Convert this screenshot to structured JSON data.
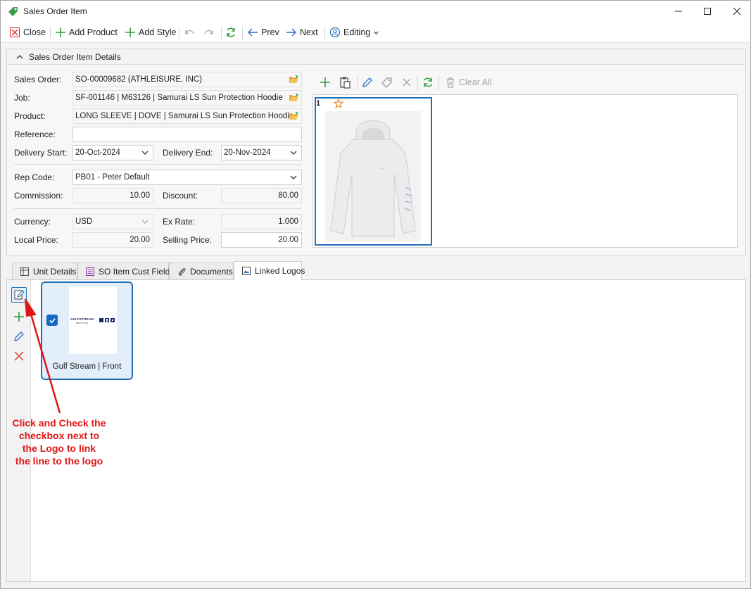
{
  "window": {
    "title": "Sales Order Item",
    "app_icon": "tag-icon"
  },
  "toolbar": {
    "close": "Close",
    "add_product": "Add Product",
    "add_style": "Add Style",
    "prev": "Prev",
    "next": "Next",
    "editing": "Editing"
  },
  "details": {
    "group_title": "Sales Order Item Details",
    "sales_order_label": "Sales Order:",
    "sales_order": "SO-00009682  (ATHLEISURE, INC)",
    "job_label": "Job:",
    "job": "SF-001146 | M63126 | Samurai LS Sun Protection Hoodie",
    "product_label": "Product:",
    "product": "LONG SLEEVE | DOVE | Samurai LS Sun Protection Hoodie",
    "reference_label": "Reference:",
    "reference": "",
    "delivery_start_label": "Delivery Start:",
    "delivery_start": "20-Oct-2024",
    "delivery_end_label": "Delivery End:",
    "delivery_end": "20-Nov-2024",
    "rep_code_label": "Rep Code:",
    "rep_code": "PB01 - Peter Default",
    "commission_label": "Commission:",
    "commission": "10.00",
    "discount_label": "Discount:",
    "discount": "80.00",
    "currency_label": "Currency:",
    "currency": "USD",
    "ex_rate_label": "Ex Rate:",
    "ex_rate": "1.000",
    "local_price_label": "Local Price:",
    "local_price": "20.00",
    "selling_price_label": "Selling Price:",
    "selling_price": "20.00"
  },
  "images": {
    "clear_all": "Clear All",
    "items": [
      {
        "number": "1",
        "favorite": true,
        "description": "white hoodie"
      }
    ]
  },
  "tabs": [
    "Unit Details",
    "SO Item Cust Fields",
    "Documents",
    "Linked Logos"
  ],
  "active_tab": "Linked Logos",
  "logos": [
    {
      "name": "Gulf Stream | Front",
      "checked": true,
      "logo_text": "GULFSTREAM",
      "logo_subtext": "BOAT CLUB"
    }
  ],
  "annotation": {
    "lines": [
      "Click and Check the",
      "checkbox next to",
      "the Logo to link",
      "the line to the logo"
    ],
    "color": "#e01515"
  },
  "colors": {
    "accent": "#1f6fb5",
    "add_green": "#2e9e3e",
    "delete_red": "#e0413a"
  }
}
